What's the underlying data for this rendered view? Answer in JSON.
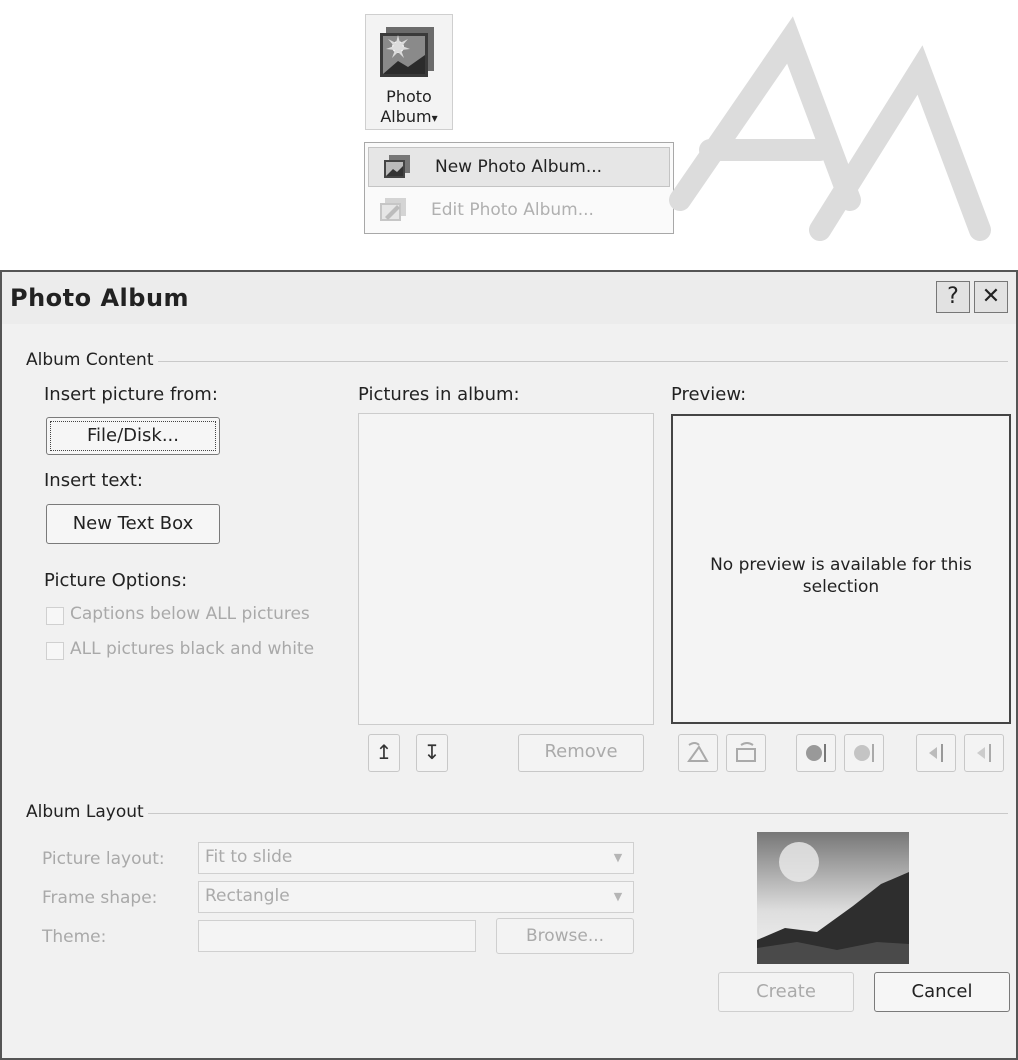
{
  "ribbon": {
    "button_line1": "Photo",
    "button_line2": "Album",
    "dropdown_arrow": "▾",
    "menu": {
      "new_label": "New Photo Album...",
      "edit_label": "Edit Photo Album..."
    }
  },
  "dialog": {
    "title": "Photo Album",
    "help_glyph": "?",
    "close_glyph": "✕",
    "album_content": {
      "group_label": "Album Content",
      "insert_picture_label": "Insert picture from:",
      "file_disk_button": "File/Disk...",
      "insert_text_label": "Insert text:",
      "new_text_box_button": "New Text Box",
      "picture_options_label": "Picture Options:",
      "captions_label": "Captions below ALL pictures",
      "black_white_label": "ALL pictures black and white",
      "pictures_in_album_label": "Pictures in album:",
      "preview_label": "Preview:",
      "preview_empty_text": "No preview is available for this selection",
      "move_up_glyph": "↥",
      "move_down_glyph": "↧",
      "remove_button": "Remove"
    },
    "album_layout": {
      "group_label": "Album Layout",
      "picture_layout_label": "Picture layout:",
      "picture_layout_value": "Fit to slide",
      "frame_shape_label": "Frame shape:",
      "frame_shape_value": "Rectangle",
      "theme_label": "Theme:",
      "theme_value": "",
      "browse_button": "Browse..."
    },
    "buttons": {
      "create": "Create",
      "cancel": "Cancel"
    }
  },
  "icons": {
    "photo_album": "photo-album-icon",
    "new_album": "new-photo-album-icon",
    "edit_album": "edit-photo-album-icon",
    "rotate_left": "rotate-left-icon",
    "rotate_right": "rotate-right-icon",
    "contrast_up": "contrast-increase-icon",
    "contrast_down": "contrast-decrease-icon",
    "brightness_up": "brightness-increase-icon",
    "brightness_down": "brightness-decrease-icon"
  }
}
